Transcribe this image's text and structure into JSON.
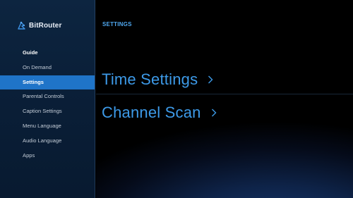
{
  "brand": {
    "name": "BitRouter",
    "logo_icon": "bitrouter-logo-icon"
  },
  "sidebar": {
    "items": [
      {
        "label": "Guide",
        "state": "header"
      },
      {
        "label": "On Demand",
        "state": "normal"
      },
      {
        "label": "Settings",
        "state": "active"
      },
      {
        "label": "Parental Controls",
        "state": "normal"
      },
      {
        "label": "Caption Settings",
        "state": "normal"
      },
      {
        "label": "Menu Language",
        "state": "normal"
      },
      {
        "label": "Audio Language",
        "state": "normal"
      },
      {
        "label": "Apps",
        "state": "normal"
      }
    ]
  },
  "main": {
    "header": "SETTINGS",
    "options": [
      {
        "label": "Time Settings",
        "icon": "chevron-right-icon"
      },
      {
        "label": "Channel Scan",
        "icon": "chevron-right-icon"
      }
    ]
  },
  "colors": {
    "accent": "#1f74c8",
    "option_text": "#3d9ae8",
    "header_text": "#4fa8f0",
    "sidebar_bg": "#0a1f38"
  }
}
